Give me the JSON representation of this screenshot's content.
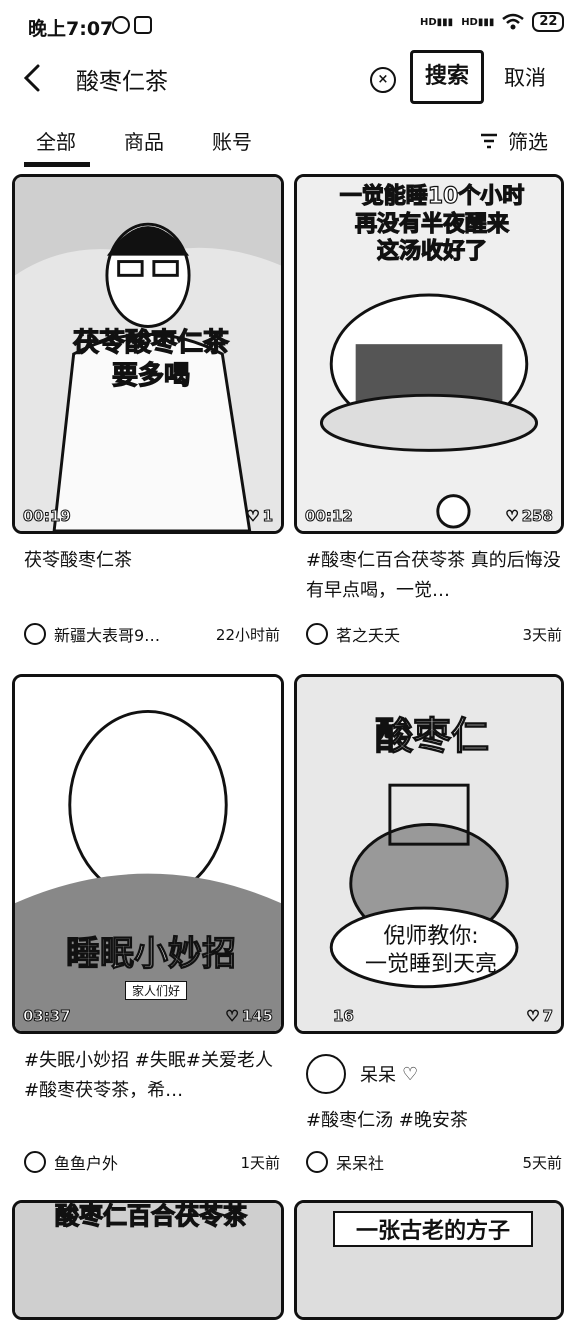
{
  "status_bar": {
    "time": "晚上7:07",
    "battery": "22",
    "signal_label": "HD"
  },
  "header": {
    "query": "酸枣仁茶",
    "search_label": "搜索",
    "cancel_label": "取消"
  },
  "tabs": [
    {
      "label": "全部"
    },
    {
      "label": "商品"
    },
    {
      "label": "账号"
    }
  ],
  "filter_label": "筛选",
  "cards": [
    {
      "overlay": "茯苓酸枣仁茶\n要多喝",
      "duration": "00:19",
      "likes": "1",
      "title": "茯苓酸枣仁茶",
      "author": "新疆大表哥9…",
      "time": "22小时前"
    },
    {
      "overlay": "一觉能睡10个小时\n再没有半夜醒来\n这汤收好了",
      "duration": "00:12",
      "likes": "258",
      "title": "#酸枣仁百合茯苓茶 真的后悔没有早点喝，一觉…",
      "author": "茗之夭夭",
      "time": "3天前"
    },
    {
      "overlay": "睡眠小妙招",
      "overlay_sub": "家人们好",
      "duration": "03:37",
      "likes": "145",
      "title": "#失眠小妙招 #失眠#关爱老人#酸枣茯苓茶，希…",
      "author": "鱼鱼户外",
      "time": "1天前"
    },
    {
      "overlay": "酸枣仁",
      "overlay2": "倪师教你:\n一觉睡到天亮",
      "duration": "16",
      "likes": "7",
      "title": "#酸枣仁汤 #晚安茶",
      "live_name": "呆呆",
      "author": "呆呆社",
      "time": "5天前"
    },
    {
      "overlay": "酸枣仁百合茯苓茶"
    },
    {
      "overlay": "一张古老的方子"
    }
  ]
}
